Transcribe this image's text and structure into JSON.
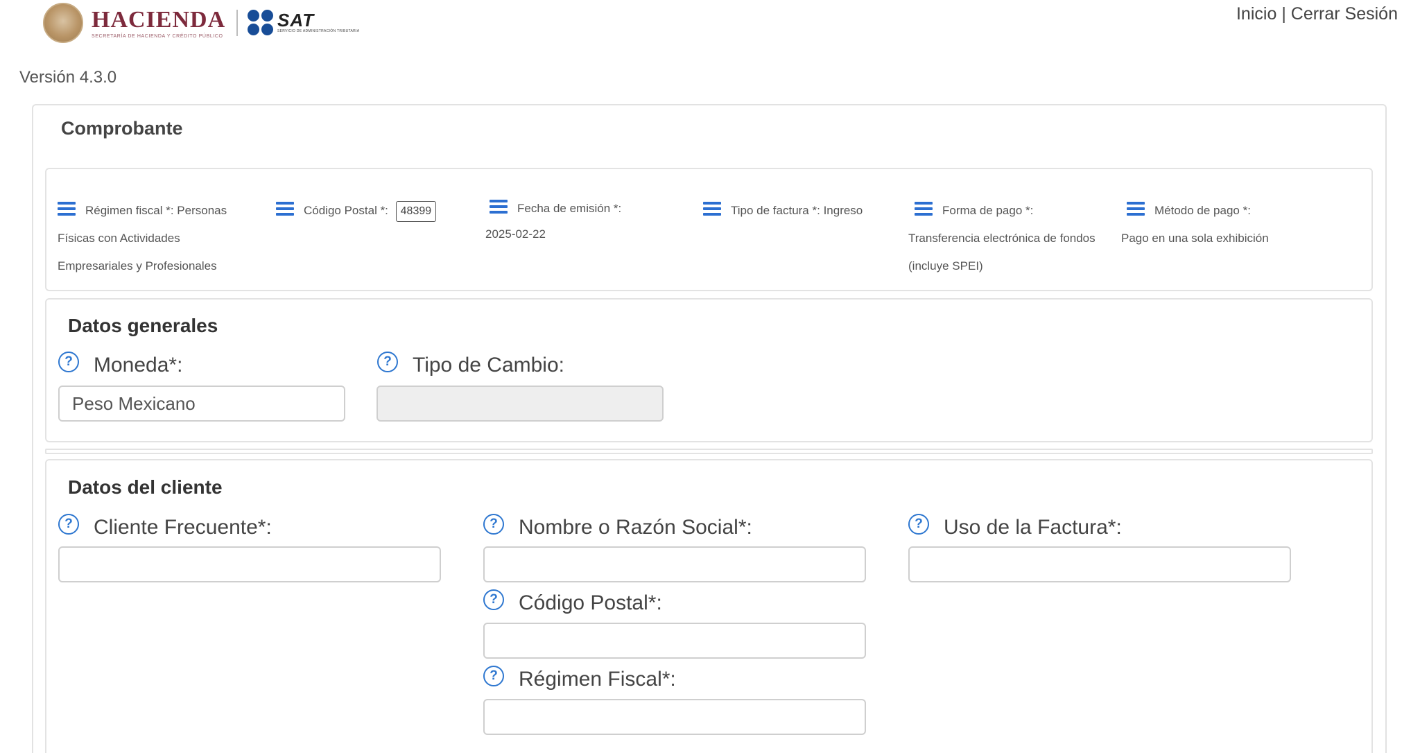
{
  "header": {
    "hacienda_title": "HACIENDA",
    "hacienda_subtitle": "SECRETARÍA DE HACIENDA Y CRÉDITO PÚBLICO",
    "sat_title": "SAT",
    "sat_subtitle": "SERVICIO DE ADMINISTRACIÓN TRIBUTARIA",
    "links": {
      "inicio": "Inicio",
      "separator": "|",
      "cerrar_sesion": "Cerrar Sesión"
    }
  },
  "version": "Versión 4.3.0",
  "comprobante": {
    "title": "Comprobante",
    "summary": {
      "regimen": {
        "label": "Régimen fiscal *:",
        "value_line1": "Personas",
        "value_line2": "Físicas con Actividades",
        "value_line3": "Empresariales y Profesionales"
      },
      "codigo_postal": {
        "label": "Código Postal *:",
        "value": "48399"
      },
      "fecha": {
        "label": "Fecha de emisión *:",
        "value": "2025-02-22"
      },
      "tipo_factura": {
        "label": "Tipo de factura *:",
        "value": "Ingreso"
      },
      "forma_pago": {
        "label": "Forma de pago *:",
        "value_line1": "Transferencia electrónica de fondos",
        "value_line2": "(incluye SPEI)"
      },
      "metodo_pago": {
        "label": "Método de pago *:",
        "value": "Pago en una sola exhibición"
      }
    }
  },
  "datos_generales": {
    "title": "Datos generales",
    "moneda": {
      "label": "Moneda*:",
      "value": "Peso Mexicano"
    },
    "tipo_cambio": {
      "label": "Tipo de Cambio:",
      "value": ""
    }
  },
  "datos_cliente": {
    "title": "Datos del cliente",
    "cliente_frecuente": {
      "label": "Cliente Frecuente*:",
      "value": ""
    },
    "nombre": {
      "label": "Nombre o Razón Social*:",
      "value": ""
    },
    "uso_factura": {
      "label": "Uso de la Factura*:",
      "value": ""
    },
    "codigo_postal": {
      "label": "Código Postal*:",
      "value": ""
    },
    "regimen_fiscal": {
      "label": "Régimen Fiscal*:",
      "value": ""
    }
  },
  "icons": {
    "help": "question-circle-icon",
    "menu": "menu-lines-icon",
    "help_glyph": "?"
  },
  "colors": {
    "accent": "#2c6fd1",
    "hacienda": "#7d2a3c",
    "sat": "#184d97"
  }
}
